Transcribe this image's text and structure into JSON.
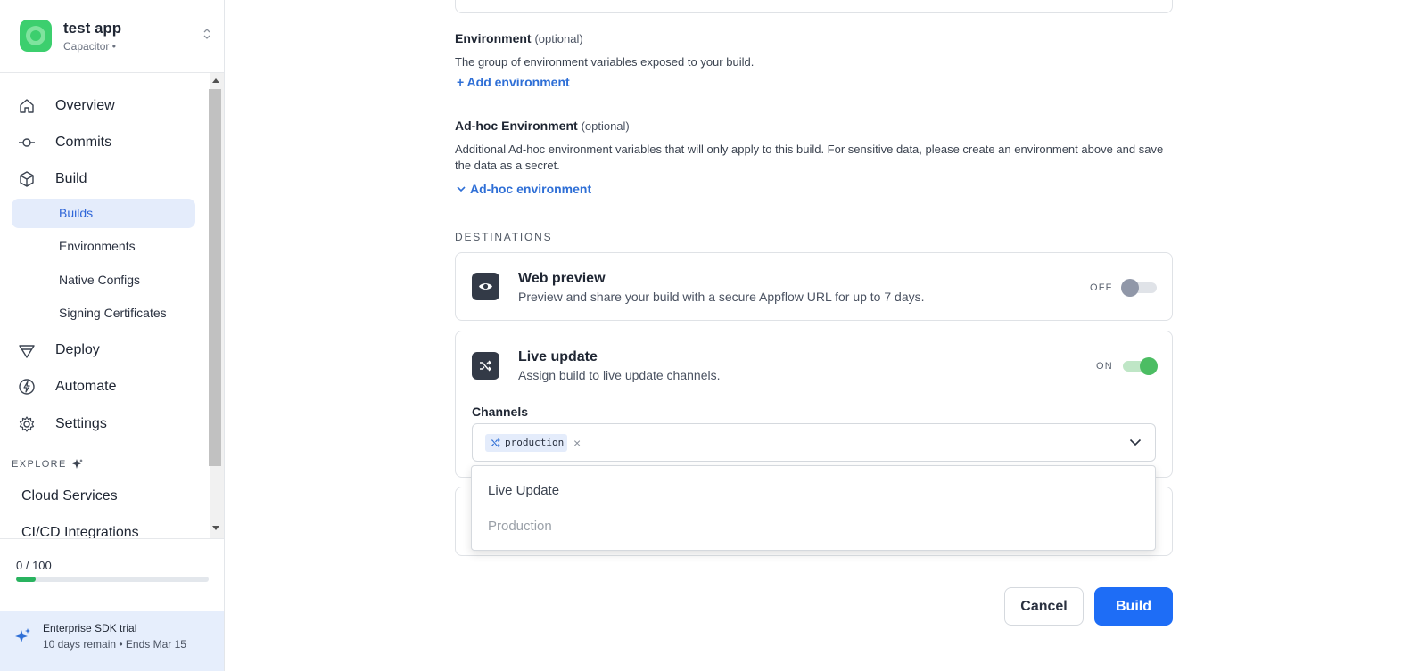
{
  "app": {
    "name": "test app",
    "subtitle": "Capacitor •"
  },
  "nav": {
    "overview": "Overview",
    "commits": "Commits",
    "build": "Build",
    "build_items": [
      "Builds",
      "Environments",
      "Native Configs",
      "Signing Certificates"
    ],
    "deploy": "Deploy",
    "automate": "Automate",
    "settings": "Settings",
    "explore_label": "EXPLORE",
    "explore_items": [
      "Cloud Services",
      "CI/CD Integrations"
    ]
  },
  "usage": {
    "text": "0 / 100",
    "progress_fraction": 0.1
  },
  "trial": {
    "title": "Enterprise SDK trial",
    "subtitle": "10 days remain • Ends Mar 15"
  },
  "form": {
    "environment": {
      "title": "Environment",
      "optional": "(optional)",
      "description": "The group of environment variables exposed to your build.",
      "add_link": "+ Add environment"
    },
    "adhoc": {
      "title": "Ad-hoc Environment",
      "optional": "(optional)",
      "description": "Additional Ad-hoc environment variables that will only apply to this build. For sensitive data, please create an environment above and save the data as a secret.",
      "toggle_link": "Ad-hoc environment"
    },
    "destinations_label": "DESTINATIONS",
    "web_preview": {
      "title": "Web preview",
      "description": "Preview and share your build with a secure Appflow URL for up to 7 days.",
      "state": "OFF"
    },
    "live_update": {
      "title": "Live update",
      "description": "Assign build to live update channels.",
      "state": "ON",
      "channels_label": "Channels",
      "selected_channel": "production",
      "remove_glyph": "×"
    },
    "dropdown": {
      "group": "Live Update",
      "option": "Production"
    },
    "cancel_label": "Cancel",
    "build_label": "Build"
  },
  "colors": {
    "accent": "#1e6df6",
    "toggle_on": "#4cbd63",
    "toggle_off": "#9097a8",
    "brand": "#3ccf6e"
  }
}
